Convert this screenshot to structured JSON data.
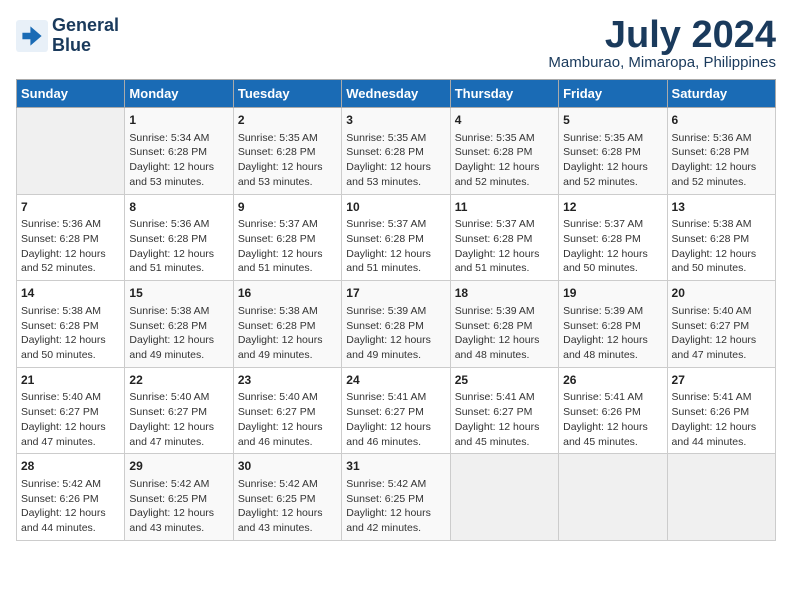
{
  "logo": {
    "line1": "General",
    "line2": "Blue"
  },
  "title": "July 2024",
  "location": "Mamburao, Mimaropa, Philippines",
  "days_header": [
    "Sunday",
    "Monday",
    "Tuesday",
    "Wednesday",
    "Thursday",
    "Friday",
    "Saturday"
  ],
  "weeks": [
    [
      {
        "day": "",
        "info": ""
      },
      {
        "day": "1",
        "info": "Sunrise: 5:34 AM\nSunset: 6:28 PM\nDaylight: 12 hours\nand 53 minutes."
      },
      {
        "day": "2",
        "info": "Sunrise: 5:35 AM\nSunset: 6:28 PM\nDaylight: 12 hours\nand 53 minutes."
      },
      {
        "day": "3",
        "info": "Sunrise: 5:35 AM\nSunset: 6:28 PM\nDaylight: 12 hours\nand 53 minutes."
      },
      {
        "day": "4",
        "info": "Sunrise: 5:35 AM\nSunset: 6:28 PM\nDaylight: 12 hours\nand 52 minutes."
      },
      {
        "day": "5",
        "info": "Sunrise: 5:35 AM\nSunset: 6:28 PM\nDaylight: 12 hours\nand 52 minutes."
      },
      {
        "day": "6",
        "info": "Sunrise: 5:36 AM\nSunset: 6:28 PM\nDaylight: 12 hours\nand 52 minutes."
      }
    ],
    [
      {
        "day": "7",
        "info": "Sunrise: 5:36 AM\nSunset: 6:28 PM\nDaylight: 12 hours\nand 52 minutes."
      },
      {
        "day": "8",
        "info": "Sunrise: 5:36 AM\nSunset: 6:28 PM\nDaylight: 12 hours\nand 51 minutes."
      },
      {
        "day": "9",
        "info": "Sunrise: 5:37 AM\nSunset: 6:28 PM\nDaylight: 12 hours\nand 51 minutes."
      },
      {
        "day": "10",
        "info": "Sunrise: 5:37 AM\nSunset: 6:28 PM\nDaylight: 12 hours\nand 51 minutes."
      },
      {
        "day": "11",
        "info": "Sunrise: 5:37 AM\nSunset: 6:28 PM\nDaylight: 12 hours\nand 51 minutes."
      },
      {
        "day": "12",
        "info": "Sunrise: 5:37 AM\nSunset: 6:28 PM\nDaylight: 12 hours\nand 50 minutes."
      },
      {
        "day": "13",
        "info": "Sunrise: 5:38 AM\nSunset: 6:28 PM\nDaylight: 12 hours\nand 50 minutes."
      }
    ],
    [
      {
        "day": "14",
        "info": "Sunrise: 5:38 AM\nSunset: 6:28 PM\nDaylight: 12 hours\nand 50 minutes."
      },
      {
        "day": "15",
        "info": "Sunrise: 5:38 AM\nSunset: 6:28 PM\nDaylight: 12 hours\nand 49 minutes."
      },
      {
        "day": "16",
        "info": "Sunrise: 5:38 AM\nSunset: 6:28 PM\nDaylight: 12 hours\nand 49 minutes."
      },
      {
        "day": "17",
        "info": "Sunrise: 5:39 AM\nSunset: 6:28 PM\nDaylight: 12 hours\nand 49 minutes."
      },
      {
        "day": "18",
        "info": "Sunrise: 5:39 AM\nSunset: 6:28 PM\nDaylight: 12 hours\nand 48 minutes."
      },
      {
        "day": "19",
        "info": "Sunrise: 5:39 AM\nSunset: 6:28 PM\nDaylight: 12 hours\nand 48 minutes."
      },
      {
        "day": "20",
        "info": "Sunrise: 5:40 AM\nSunset: 6:27 PM\nDaylight: 12 hours\nand 47 minutes."
      }
    ],
    [
      {
        "day": "21",
        "info": "Sunrise: 5:40 AM\nSunset: 6:27 PM\nDaylight: 12 hours\nand 47 minutes."
      },
      {
        "day": "22",
        "info": "Sunrise: 5:40 AM\nSunset: 6:27 PM\nDaylight: 12 hours\nand 47 minutes."
      },
      {
        "day": "23",
        "info": "Sunrise: 5:40 AM\nSunset: 6:27 PM\nDaylight: 12 hours\nand 46 minutes."
      },
      {
        "day": "24",
        "info": "Sunrise: 5:41 AM\nSunset: 6:27 PM\nDaylight: 12 hours\nand 46 minutes."
      },
      {
        "day": "25",
        "info": "Sunrise: 5:41 AM\nSunset: 6:27 PM\nDaylight: 12 hours\nand 45 minutes."
      },
      {
        "day": "26",
        "info": "Sunrise: 5:41 AM\nSunset: 6:26 PM\nDaylight: 12 hours\nand 45 minutes."
      },
      {
        "day": "27",
        "info": "Sunrise: 5:41 AM\nSunset: 6:26 PM\nDaylight: 12 hours\nand 44 minutes."
      }
    ],
    [
      {
        "day": "28",
        "info": "Sunrise: 5:42 AM\nSunset: 6:26 PM\nDaylight: 12 hours\nand 44 minutes."
      },
      {
        "day": "29",
        "info": "Sunrise: 5:42 AM\nSunset: 6:25 PM\nDaylight: 12 hours\nand 43 minutes."
      },
      {
        "day": "30",
        "info": "Sunrise: 5:42 AM\nSunset: 6:25 PM\nDaylight: 12 hours\nand 43 minutes."
      },
      {
        "day": "31",
        "info": "Sunrise: 5:42 AM\nSunset: 6:25 PM\nDaylight: 12 hours\nand 42 minutes."
      },
      {
        "day": "",
        "info": ""
      },
      {
        "day": "",
        "info": ""
      },
      {
        "day": "",
        "info": ""
      }
    ]
  ]
}
